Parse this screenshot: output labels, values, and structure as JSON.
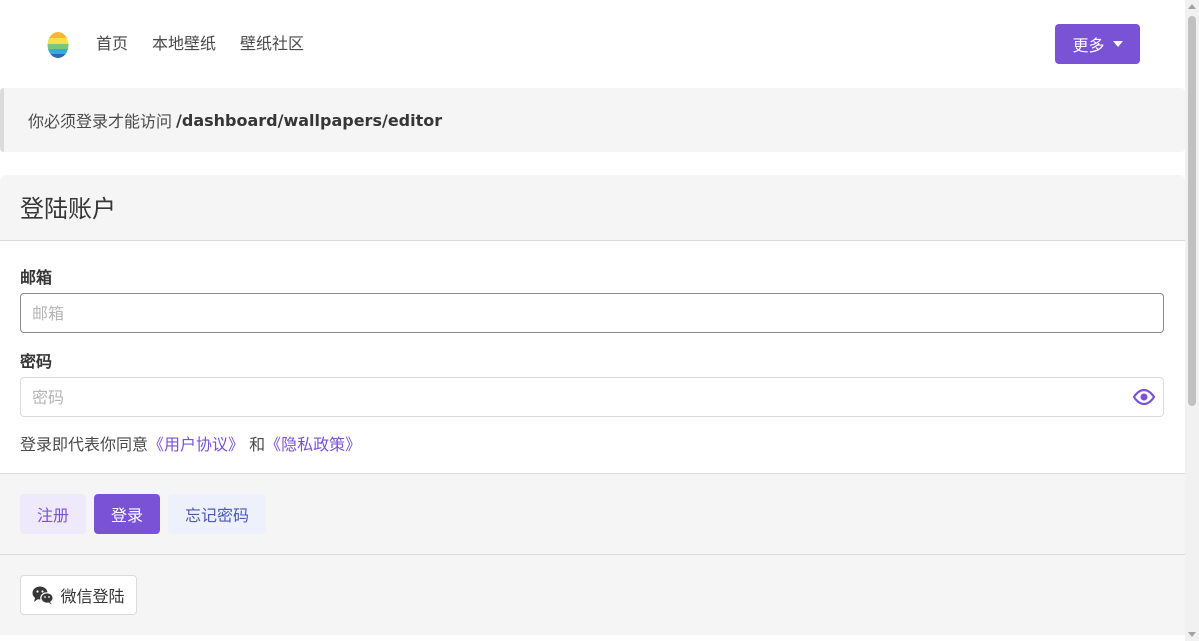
{
  "nav": {
    "home": "首页",
    "local": "本地壁纸",
    "community": "壁纸社区",
    "more": "更多"
  },
  "notice": {
    "text": "你必须登录才能访问",
    "path": "/dashboard/wallpapers/editor"
  },
  "login": {
    "title": "登陆账户",
    "email_label": "邮箱",
    "email_placeholder": "邮箱",
    "email_value": "",
    "password_label": "密码",
    "password_placeholder": "密码",
    "password_value": "",
    "agree_prefix": "登录即代表你同意",
    "user_agreement": "《用户协议》",
    "and": " 和",
    "privacy_policy": "《隐私政策》"
  },
  "actions": {
    "register": "注册",
    "login": "登录",
    "forgot": "忘记密码"
  },
  "social": {
    "wechat": "微信登陆"
  },
  "colors": {
    "accent": "#7a52d6",
    "panel": "#f5f5f5",
    "border": "#dbdbdb"
  },
  "icons": {
    "logo": "rainbow-egg-logo",
    "more_caret": "caret-down-icon",
    "eye": "eye-icon",
    "wechat": "wechat-icon"
  }
}
